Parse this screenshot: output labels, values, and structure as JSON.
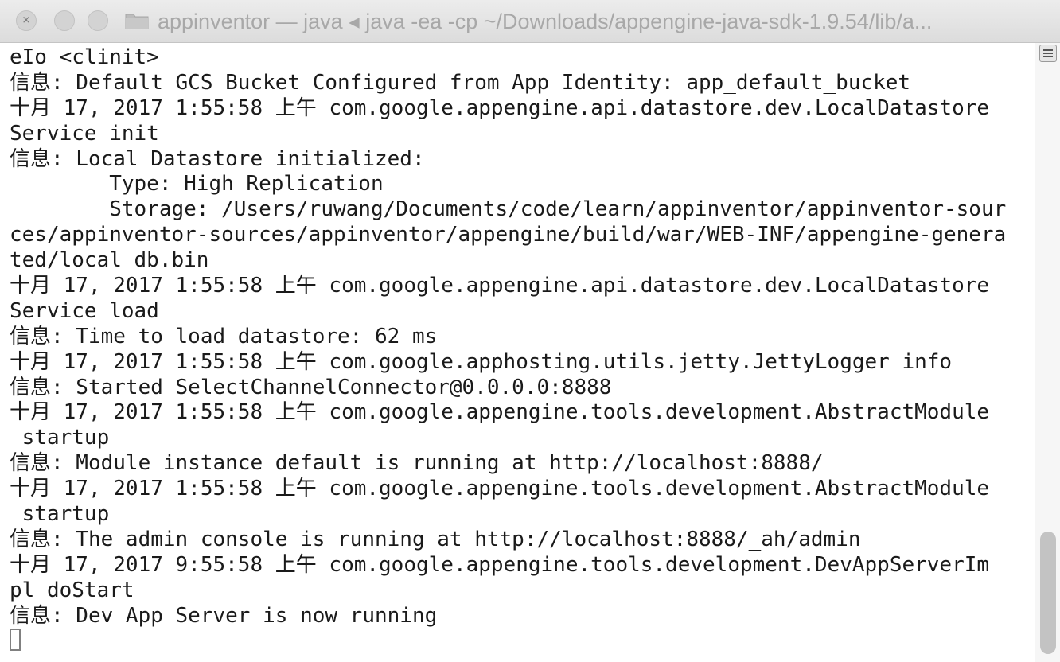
{
  "window": {
    "title": "appinventor — java ◂ java -ea -cp ~/Downloads/appengine-java-sdk-1.9.54/lib/a..."
  },
  "traffic_lights": {
    "close_glyph": "×"
  },
  "icons": {
    "folder": "folder-icon",
    "close": "close-icon",
    "minimize": "minimize-icon",
    "zoom": "zoom-icon",
    "scroll_menu": "menu-icon"
  },
  "terminal": {
    "lines": [
      "eIo <clinit>",
      "信息: Default GCS Bucket Configured from App Identity: app_default_bucket",
      "十月 17, 2017 1:55:58 上午 com.google.appengine.api.datastore.dev.LocalDatastore",
      "Service init",
      "信息: Local Datastore initialized:",
      "        Type: High Replication",
      "        Storage: /Users/ruwang/Documents/code/learn/appinventor/appinventor-sour",
      "ces/appinventor-sources/appinventor/appengine/build/war/WEB-INF/appengine-genera",
      "ted/local_db.bin",
      "十月 17, 2017 1:55:58 上午 com.google.appengine.api.datastore.dev.LocalDatastore",
      "Service load",
      "信息: Time to load datastore: 62 ms",
      "十月 17, 2017 1:55:58 上午 com.google.apphosting.utils.jetty.JettyLogger info",
      "信息: Started SelectChannelConnector@0.0.0.0:8888",
      "十月 17, 2017 1:55:58 上午 com.google.appengine.tools.development.AbstractModule",
      " startup",
      "信息: Module instance default is running at http://localhost:8888/",
      "十月 17, 2017 1:55:58 上午 com.google.appengine.tools.development.AbstractModule",
      " startup",
      "信息: The admin console is running at http://localhost:8888/_ah/admin",
      "十月 17, 2017 9:55:58 上午 com.google.appengine.tools.development.DevAppServerIm",
      "pl doStart",
      "信息: Dev App Server is now running"
    ]
  },
  "colors": {
    "text": "#1a1a1a",
    "title_text": "#a8a8a8",
    "titlebar": "#e3e3e3",
    "scroll_thumb": "#c3c3c3",
    "background": "#ffffff"
  }
}
